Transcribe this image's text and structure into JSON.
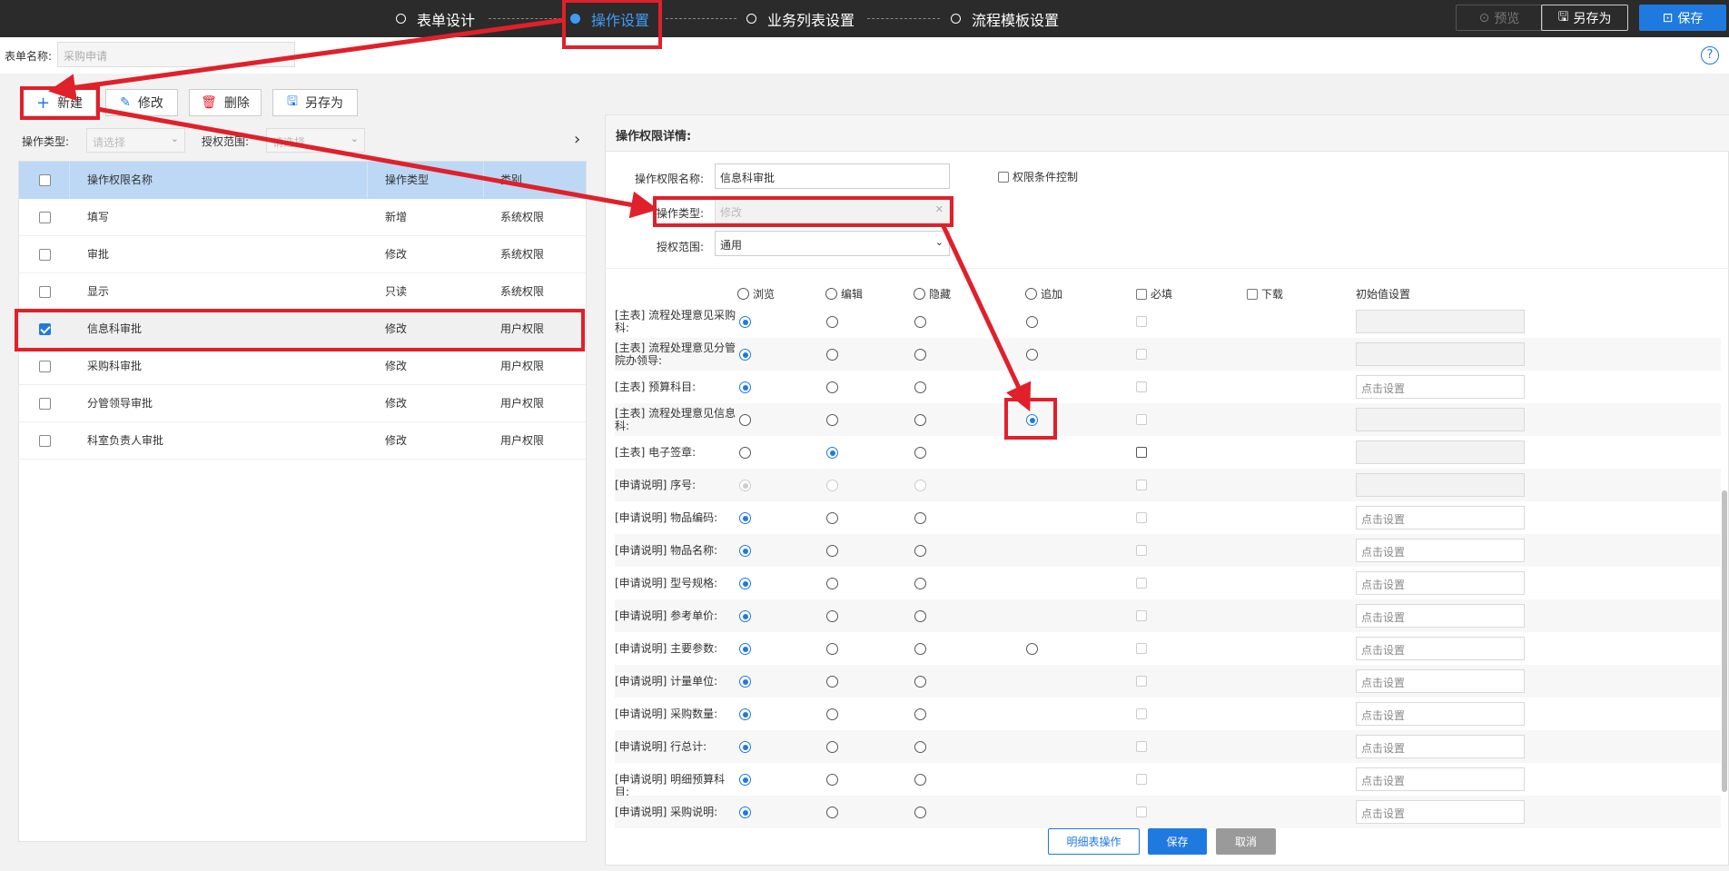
{
  "steps": [
    {
      "label": "表单设计",
      "active": false
    },
    {
      "label": "操作设置",
      "active": true
    },
    {
      "label": "业务列表设置",
      "active": false
    },
    {
      "label": "流程模板设置",
      "active": false
    }
  ],
  "top_buttons": {
    "preview": "预览",
    "save_as": "另存为",
    "save": "保存"
  },
  "form_name": {
    "label": "表单名称:",
    "value": "采购申请"
  },
  "toolbar": {
    "new": "新建",
    "edit": "修改",
    "delete": "删除",
    "save_as": "另存为"
  },
  "filters": {
    "op_type_label": "操作类型:",
    "op_type_placeholder": "请选择",
    "scope_label": "授权范围:",
    "scope_placeholder": "请选择"
  },
  "list": {
    "headers": [
      "操作权限名称",
      "操作类型",
      "类别"
    ],
    "rows": [
      {
        "name": "填写",
        "type": "新增",
        "category": "系统权限",
        "checked": false
      },
      {
        "name": "审批",
        "type": "修改",
        "category": "系统权限",
        "checked": false
      },
      {
        "name": "显示",
        "type": "只读",
        "category": "系统权限",
        "checked": false
      },
      {
        "name": "信息科审批",
        "type": "修改",
        "category": "用户权限",
        "checked": true
      },
      {
        "name": "采购科审批",
        "type": "修改",
        "category": "用户权限",
        "checked": false
      },
      {
        "name": "分管领导审批",
        "type": "修改",
        "category": "用户权限",
        "checked": false
      },
      {
        "name": "科室负责人审批",
        "type": "修改",
        "category": "用户权限",
        "checked": false
      }
    ]
  },
  "detail": {
    "title": "操作权限详情:",
    "name_label": "操作权限名称:",
    "name_value": "信息科审批",
    "condition_label": "权限条件控制",
    "type_label": "操作类型:",
    "type_value": "修改",
    "scope_label": "授权范围:",
    "scope_value": "通用",
    "columns": [
      "浏览",
      "编辑",
      "隐藏",
      "追加",
      "必填",
      "下载",
      "初始值设置"
    ],
    "init_placeholder": "点击设置",
    "fields": [
      {
        "label": "[主表] 流程处理意见采购科:",
        "sel": "browse",
        "append": true,
        "req": false,
        "init": ""
      },
      {
        "label": "[主表] 流程处理意见分管院办领导:",
        "sel": "browse",
        "append": true,
        "req": false,
        "init": ""
      },
      {
        "label": "[主表] 预算科目:",
        "sel": "browse",
        "append": false,
        "req": false,
        "init": "点击设置"
      },
      {
        "label": "[主表] 流程处理意见信息科:",
        "sel": "append",
        "append": true,
        "req": false,
        "init": ""
      },
      {
        "label": "[主表] 电子签章:",
        "sel": "edit",
        "append": false,
        "req": true,
        "init": ""
      },
      {
        "label": "[申请说明] 序号:",
        "sel": "browse-disabled",
        "append": false,
        "req": false,
        "init": ""
      },
      {
        "label": "[申请说明] 物品编码:",
        "sel": "browse",
        "append": false,
        "req": false,
        "init": "点击设置"
      },
      {
        "label": "[申请说明] 物品名称:",
        "sel": "browse",
        "append": false,
        "req": false,
        "init": "点击设置"
      },
      {
        "label": "[申请说明] 型号规格:",
        "sel": "browse",
        "append": false,
        "req": false,
        "init": "点击设置"
      },
      {
        "label": "[申请说明] 参考单价:",
        "sel": "browse",
        "append": false,
        "req": false,
        "init": "点击设置"
      },
      {
        "label": "[申请说明] 主要参数:",
        "sel": "browse",
        "append": true,
        "req": false,
        "init": "点击设置"
      },
      {
        "label": "[申请说明] 计量单位:",
        "sel": "browse",
        "append": false,
        "req": false,
        "init": "点击设置"
      },
      {
        "label": "[申请说明] 采购数量:",
        "sel": "browse",
        "append": false,
        "req": false,
        "init": "点击设置"
      },
      {
        "label": "[申请说明] 行总计:",
        "sel": "browse",
        "append": false,
        "req": false,
        "init": "点击设置"
      },
      {
        "label": "[申请说明] 明细预算科目:",
        "sel": "browse",
        "append": false,
        "req": false,
        "init": "点击设置"
      },
      {
        "label": "[申请说明] 采购说明:",
        "sel": "browse",
        "append": false,
        "req": false,
        "init": "点击设置"
      }
    ]
  },
  "bottom_buttons": {
    "detail_op": "明细表操作",
    "save": "保存",
    "cancel": "取消"
  },
  "colors": {
    "accent": "#1f7ae0",
    "annotation": "#e0202a",
    "topbar": "#2b2b2b",
    "header_row": "#bcd8f5"
  }
}
